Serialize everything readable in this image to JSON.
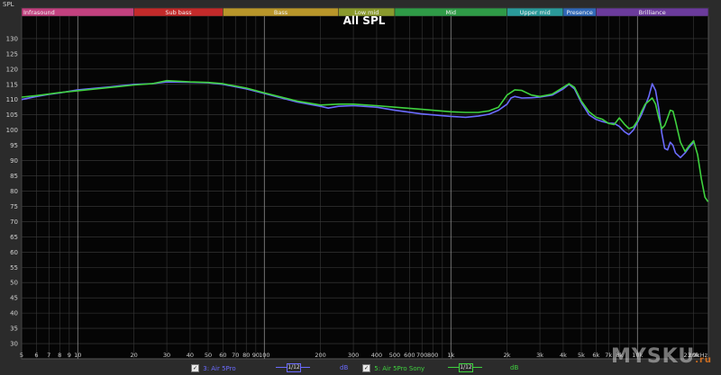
{
  "chart_data": {
    "type": "line",
    "title": "All SPL",
    "ylabel": "SPL",
    "x_scale": "log",
    "xlim": [
      5,
      24000
    ],
    "ylim": [
      25,
      140
    ],
    "grid": true,
    "bands": [
      {
        "label": "Infrasound",
        "from": 5,
        "to": 20,
        "color": "#c2417f"
      },
      {
        "label": "Sub bass",
        "from": 20,
        "to": 60,
        "color": "#c32a2a"
      },
      {
        "label": "Bass",
        "from": 60,
        "to": 250,
        "color": "#b9962a"
      },
      {
        "label": "Low mid",
        "from": 250,
        "to": 500,
        "color": "#8a9a2d"
      },
      {
        "label": "Mid",
        "from": 500,
        "to": 2000,
        "color": "#2f9b47"
      },
      {
        "label": "Upper mid",
        "from": 2000,
        "to": 4000,
        "color": "#2a9a9a"
      },
      {
        "label": "Presence",
        "from": 4000,
        "to": 6000,
        "color": "#3169b8"
      },
      {
        "label": "Brilliance",
        "from": 6000,
        "to": 20000,
        "color": "#6b3b9c"
      }
    ],
    "y_ticks": [
      130,
      125,
      120,
      115,
      110,
      105,
      100,
      95,
      90,
      85,
      80,
      75,
      70,
      65,
      60,
      55,
      50,
      45,
      40,
      35,
      30
    ],
    "x_ticks": [
      {
        "v": 5,
        "t": "5"
      },
      {
        "v": 6,
        "t": "6"
      },
      {
        "v": 7,
        "t": "7"
      },
      {
        "v": 8,
        "t": "8"
      },
      {
        "v": 9,
        "t": "9"
      },
      {
        "v": 10,
        "t": "10"
      },
      {
        "v": 20,
        "t": "20"
      },
      {
        "v": 30,
        "t": "30"
      },
      {
        "v": 40,
        "t": "40"
      },
      {
        "v": 50,
        "t": "50"
      },
      {
        "v": 60,
        "t": "60"
      },
      {
        "v": 70,
        "t": "70"
      },
      {
        "v": 80,
        "t": "80"
      },
      {
        "v": 90,
        "t": "90"
      },
      {
        "v": 100,
        "t": "100"
      },
      {
        "v": 200,
        "t": "200"
      },
      {
        "v": 300,
        "t": "300"
      },
      {
        "v": 400,
        "t": "400"
      },
      {
        "v": 500,
        "t": "500"
      },
      {
        "v": 600,
        "t": "600"
      },
      {
        "v": 700,
        "t": "700"
      },
      {
        "v": 800,
        "t": "800"
      },
      {
        "v": 1000,
        "t": "1k"
      },
      {
        "v": 2000,
        "t": "2k"
      },
      {
        "v": 3000,
        "t": "3k"
      },
      {
        "v": 4000,
        "t": "4k"
      },
      {
        "v": 5000,
        "t": "5k"
      },
      {
        "v": 6000,
        "t": "6k"
      },
      {
        "v": 7000,
        "t": "7k"
      },
      {
        "v": 8000,
        "t": "8k"
      },
      {
        "v": 10000,
        "t": "10k"
      },
      {
        "v": 20000,
        "t": "20k"
      },
      {
        "v": 23900,
        "t": "23.9kHz"
      }
    ],
    "series": [
      {
        "name": "3: Air 5Pro",
        "color": "#6b6bff",
        "points": [
          [
            5,
            110
          ],
          [
            6,
            111
          ],
          [
            7,
            111.7
          ],
          [
            8,
            112.2
          ],
          [
            10,
            113.2
          ],
          [
            15,
            114.2
          ],
          [
            20,
            115
          ],
          [
            25,
            115.2
          ],
          [
            30,
            115.8
          ],
          [
            40,
            115.7
          ],
          [
            50,
            115.5
          ],
          [
            60,
            115
          ],
          [
            80,
            113.5
          ],
          [
            100,
            112
          ],
          [
            150,
            109.2
          ],
          [
            200,
            107.8
          ],
          [
            220,
            107.2
          ],
          [
            250,
            107.8
          ],
          [
            300,
            108
          ],
          [
            400,
            107.5
          ],
          [
            500,
            106.5
          ],
          [
            700,
            105.3
          ],
          [
            1000,
            104.5
          ],
          [
            1200,
            104.2
          ],
          [
            1400,
            104.6
          ],
          [
            1600,
            105.2
          ],
          [
            1800,
            106.5
          ],
          [
            2000,
            108.5
          ],
          [
            2100,
            110.5
          ],
          [
            2200,
            111
          ],
          [
            2400,
            110.5
          ],
          [
            2700,
            110.6
          ],
          [
            3000,
            110.8
          ],
          [
            3500,
            111.5
          ],
          [
            4000,
            113.5
          ],
          [
            4300,
            115
          ],
          [
            4600,
            113.5
          ],
          [
            5000,
            109
          ],
          [
            5500,
            105
          ],
          [
            6000,
            103.5
          ],
          [
            6500,
            102.8
          ],
          [
            7000,
            102.3
          ],
          [
            7500,
            102.2
          ],
          [
            8000,
            101.2
          ],
          [
            8500,
            99.5
          ],
          [
            9000,
            98.5
          ],
          [
            9500,
            100
          ],
          [
            10000,
            102.5
          ],
          [
            10500,
            105
          ],
          [
            11000,
            108
          ],
          [
            11500,
            111
          ],
          [
            12000,
            115.2
          ],
          [
            12500,
            113
          ],
          [
            13000,
            107
          ],
          [
            13500,
            99
          ],
          [
            14000,
            94
          ],
          [
            14500,
            93.5
          ],
          [
            15000,
            96
          ],
          [
            15500,
            95
          ],
          [
            16000,
            92.5
          ],
          [
            17000,
            91
          ],
          [
            18000,
            92.5
          ],
          [
            19000,
            94.5
          ],
          [
            20000,
            96
          ]
        ]
      },
      {
        "name": "5: Air 5Pro Sony",
        "color": "#3fd23f",
        "points": [
          [
            5,
            110.8
          ],
          [
            6,
            111.3
          ],
          [
            7,
            111.8
          ],
          [
            8,
            112.3
          ],
          [
            10,
            112.9
          ],
          [
            15,
            114
          ],
          [
            20,
            114.8
          ],
          [
            25,
            115.2
          ],
          [
            30,
            116.2
          ],
          [
            40,
            115.8
          ],
          [
            50,
            115.6
          ],
          [
            60,
            115.2
          ],
          [
            80,
            113.8
          ],
          [
            100,
            112.2
          ],
          [
            150,
            109.5
          ],
          [
            200,
            108.2
          ],
          [
            250,
            108.5
          ],
          [
            300,
            108.5
          ],
          [
            400,
            108
          ],
          [
            500,
            107.5
          ],
          [
            700,
            106.8
          ],
          [
            1000,
            106
          ],
          [
            1200,
            105.8
          ],
          [
            1400,
            105.8
          ],
          [
            1600,
            106.3
          ],
          [
            1800,
            107.5
          ],
          [
            2000,
            111.5
          ],
          [
            2200,
            113.2
          ],
          [
            2400,
            113
          ],
          [
            2700,
            111.5
          ],
          [
            3000,
            111
          ],
          [
            3500,
            111.8
          ],
          [
            4000,
            114
          ],
          [
            4300,
            115.2
          ],
          [
            4600,
            114
          ],
          [
            5000,
            109.5
          ],
          [
            5500,
            106
          ],
          [
            6000,
            104.2
          ],
          [
            6500,
            103.5
          ],
          [
            7000,
            102.2
          ],
          [
            7500,
            101.8
          ],
          [
            8000,
            104
          ],
          [
            8500,
            102
          ],
          [
            9000,
            100.5
          ],
          [
            9500,
            101
          ],
          [
            10000,
            103
          ],
          [
            10500,
            106
          ],
          [
            11000,
            108.5
          ],
          [
            11500,
            109.5
          ],
          [
            12000,
            110.5
          ],
          [
            12500,
            108.5
          ],
          [
            13000,
            104
          ],
          [
            13500,
            100.5
          ],
          [
            14000,
            101.5
          ],
          [
            14500,
            104
          ],
          [
            15000,
            106.5
          ],
          [
            15500,
            106.2
          ],
          [
            16000,
            103
          ],
          [
            17000,
            96
          ],
          [
            18000,
            93
          ],
          [
            19000,
            95
          ],
          [
            20000,
            96.5
          ],
          [
            21000,
            92
          ],
          [
            22000,
            84
          ],
          [
            23000,
            78
          ],
          [
            23900,
            76.5
          ]
        ]
      }
    ]
  },
  "legend": {
    "items": [
      {
        "check": "✓",
        "label": "3: Air 5Pro",
        "smoothing": "1/12",
        "unit": "dB",
        "color": "#6b6bff"
      },
      {
        "check": "✓",
        "label": "5: Air 5Pro Sony",
        "smoothing": "1/12",
        "unit": "dB",
        "color": "#3fd23f"
      }
    ]
  },
  "watermark": {
    "text": "MYSKU",
    "suffix": ".ru"
  }
}
